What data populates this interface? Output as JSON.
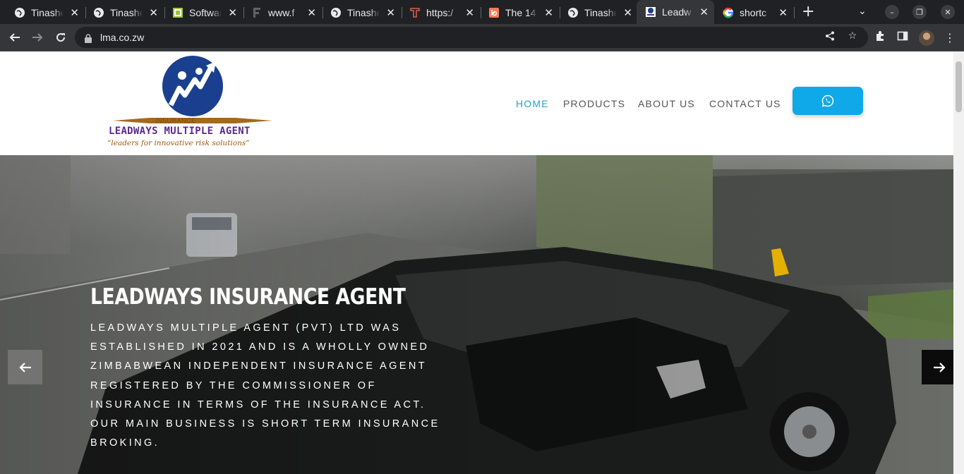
{
  "browser": {
    "tabs": [
      {
        "title": "Tinashe",
        "icon": "globe-icon"
      },
      {
        "title": "Tinashe",
        "icon": "globe-icon"
      },
      {
        "title": "Software",
        "icon": "green-square-icon"
      },
      {
        "title": "www.f",
        "icon": "letter-f-icon"
      },
      {
        "title": "Tinashe",
        "icon": "globe-icon"
      },
      {
        "title": "https:/",
        "icon": "red-t-icon"
      },
      {
        "title": "The 14",
        "icon": "hubspot-icon"
      },
      {
        "title": "Tinashe",
        "icon": "globe-icon"
      },
      {
        "title": "Leadw",
        "icon": "leadways-icon",
        "active": true
      },
      {
        "title": "shortc",
        "icon": "google-icon"
      }
    ],
    "url": "lma.co.zw"
  },
  "logo": {
    "band_text": "INSURANCE",
    "name": "LEADWAYS MULTIPLE AGENT",
    "tagline": "“leaders for innovative risk solutions”"
  },
  "nav": {
    "home": "HOME",
    "products": "PRODUCTS",
    "about": "ABOUT US",
    "contact": "CONTACT US"
  },
  "hero": {
    "title": "LEADWAYS INSURANCE AGENT",
    "lines": [
      "LEADWAYS MULTIPLE AGENT (PVT) LTD WAS",
      "ESTABLISHED IN 2021 AND IS A WHOLLY OWNED",
      "ZIMBABWEAN INDEPENDENT INSURANCE AGENT",
      "REGISTERED BY THE COMMISSIONER OF",
      "INSURANCE IN TERMS OF THE INSURANCE ACT.",
      "OUR MAIN BUSINESS IS SHORT TERM INSURANCE",
      "BROKING."
    ]
  },
  "colors": {
    "accent": "#22a3d3",
    "whatsapp_button": "#0fa8e8",
    "logo_purple": "#5a2b8c",
    "logo_blue": "#1b3f8f"
  }
}
